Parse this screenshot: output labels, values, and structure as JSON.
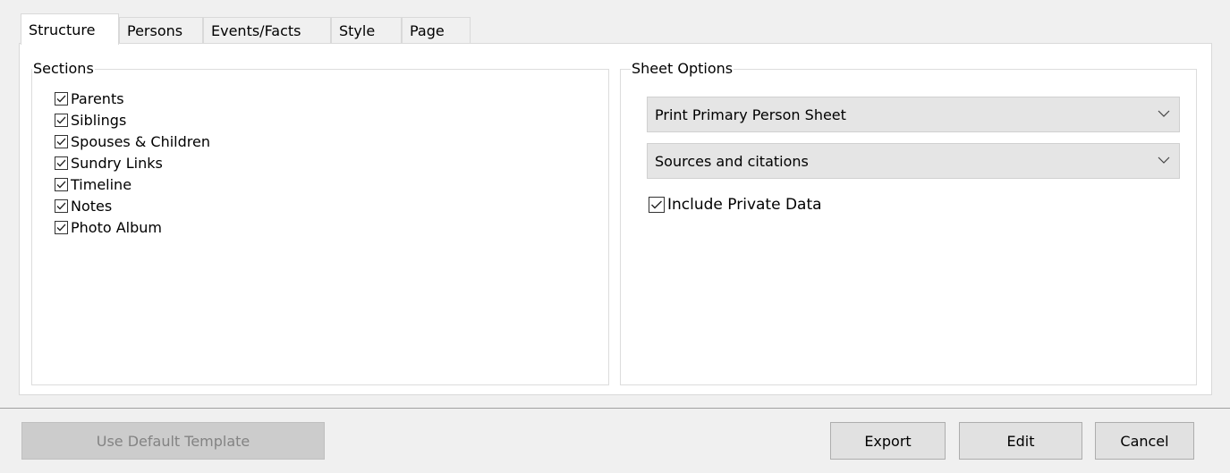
{
  "tabs": [
    {
      "label": "Structure",
      "active": true
    },
    {
      "label": "Persons",
      "active": false
    },
    {
      "label": "Events/Facts",
      "active": false
    },
    {
      "label": "Style",
      "active": false
    },
    {
      "label": "Page",
      "active": false
    }
  ],
  "sections": {
    "title": "Sections",
    "items": [
      {
        "label": "Parents",
        "checked": true
      },
      {
        "label": "Siblings",
        "checked": true
      },
      {
        "label": "Spouses & Children",
        "checked": true
      },
      {
        "label": "Sundry Links",
        "checked": true
      },
      {
        "label": "Timeline",
        "checked": true
      },
      {
        "label": "Notes",
        "checked": true
      },
      {
        "label": "Photo Album",
        "checked": true
      }
    ]
  },
  "sheet_options": {
    "title": "Sheet Options",
    "sheet_dropdown": "Print Primary Person Sheet",
    "citations_dropdown": "Sources and citations",
    "include_private": {
      "label": "Include Private Data",
      "checked": true
    }
  },
  "buttons": {
    "use_default": "Use Default Template",
    "export": "Export",
    "edit": "Edit",
    "cancel": "Cancel"
  },
  "icons": {
    "checkmark": "checkmark-icon",
    "dropdown_arrow": "chevron-down-icon"
  }
}
